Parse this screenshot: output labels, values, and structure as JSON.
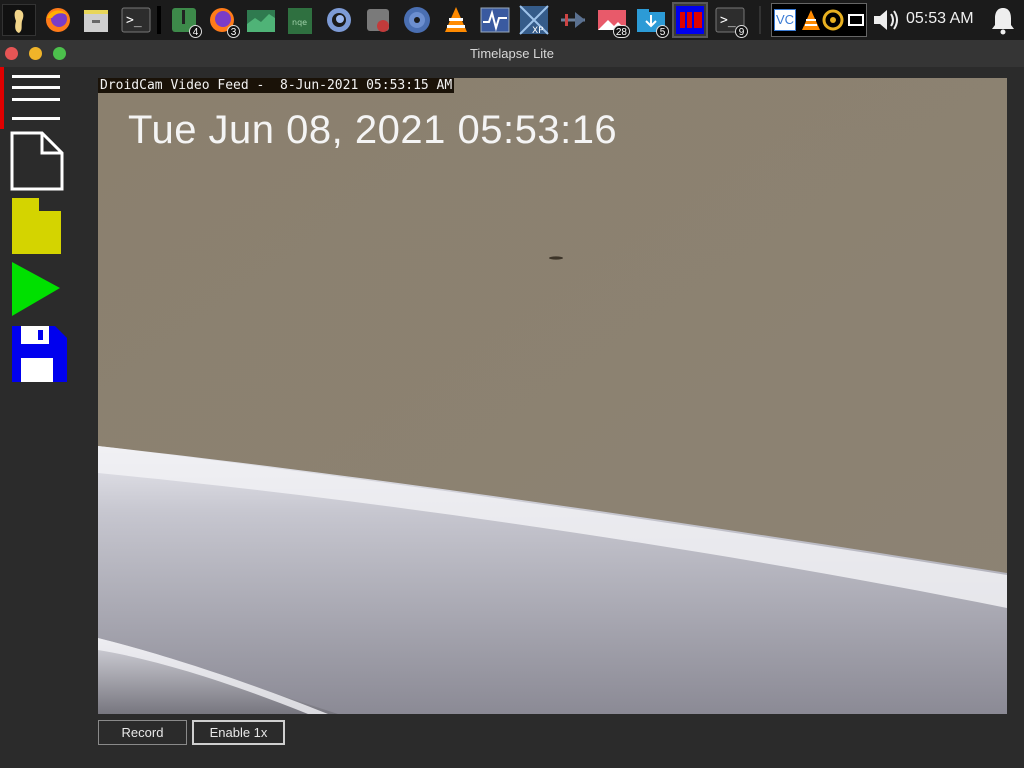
{
  "window": {
    "title": "Timelapse Lite"
  },
  "panel": {
    "clock": "05:53 AM",
    "badges": {
      "files": "4",
      "firefox": "3",
      "photos": "28",
      "downloads": "5",
      "terminal": "9"
    }
  },
  "tray": {
    "vc_label": "VC"
  },
  "video": {
    "overlay_text": "DroidCam Video Feed -  8-Jun-2021 05:53:15 AM",
    "timestamp": "Tue Jun 08, 2021 05:53:16"
  },
  "buttons": {
    "record": "Record",
    "enable": "Enable 1x"
  },
  "colors": {
    "close": "#e65555",
    "minimize": "#f0b429",
    "maximize": "#4cc04c",
    "folder": "#d4d400",
    "play": "#00e000",
    "floppy": "#0000ee",
    "record_strip": "#e00000"
  }
}
